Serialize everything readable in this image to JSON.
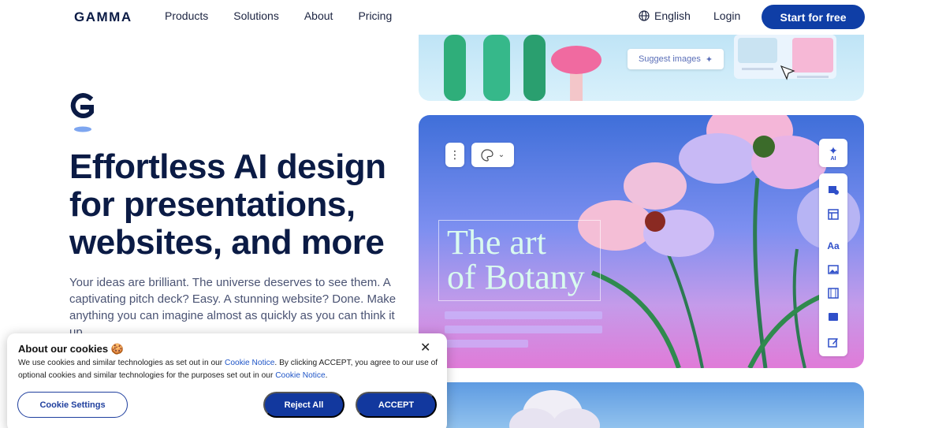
{
  "header": {
    "logo": "GAMMA",
    "nav": [
      "Products",
      "Solutions",
      "About",
      "Pricing"
    ],
    "language": "English",
    "login": "Login",
    "cta": "Start for free"
  },
  "hero": {
    "headline_lines": [
      "Effortless AI design",
      "for presentations,",
      "websites, and more"
    ],
    "subtext": "Your ideas are brilliant. The universe deserves to see them. A captivating pitch deck? Easy. A stunning website? Done. Make anything you can imagine almost as quickly as you can think it up."
  },
  "preview": {
    "suggest_images": "Suggest images",
    "slide_title_line1": "The art",
    "slide_title_line2": "of Botany",
    "ai_badge": "AI",
    "text_tool": "Aa"
  },
  "cookie": {
    "title": "About our cookies 🍪",
    "body_1": "We use cookies and similar technologies as set out in our ",
    "link_1": "Cookie Notice",
    "body_2": ". By clicking ACCEPT, you agree to our use of optional cookies and similar technologies for the purposes set out in our ",
    "link_2": "Cookie Notice",
    "body_3": ".",
    "close": "✕",
    "settings_label": "Cookie Settings",
    "reject_label": "Reject All",
    "accept_label": "ACCEPT"
  },
  "colors": {
    "brand_navy": "#0b1b45",
    "button_blue": "#0f3ea6",
    "link_blue": "#1f55c7"
  }
}
